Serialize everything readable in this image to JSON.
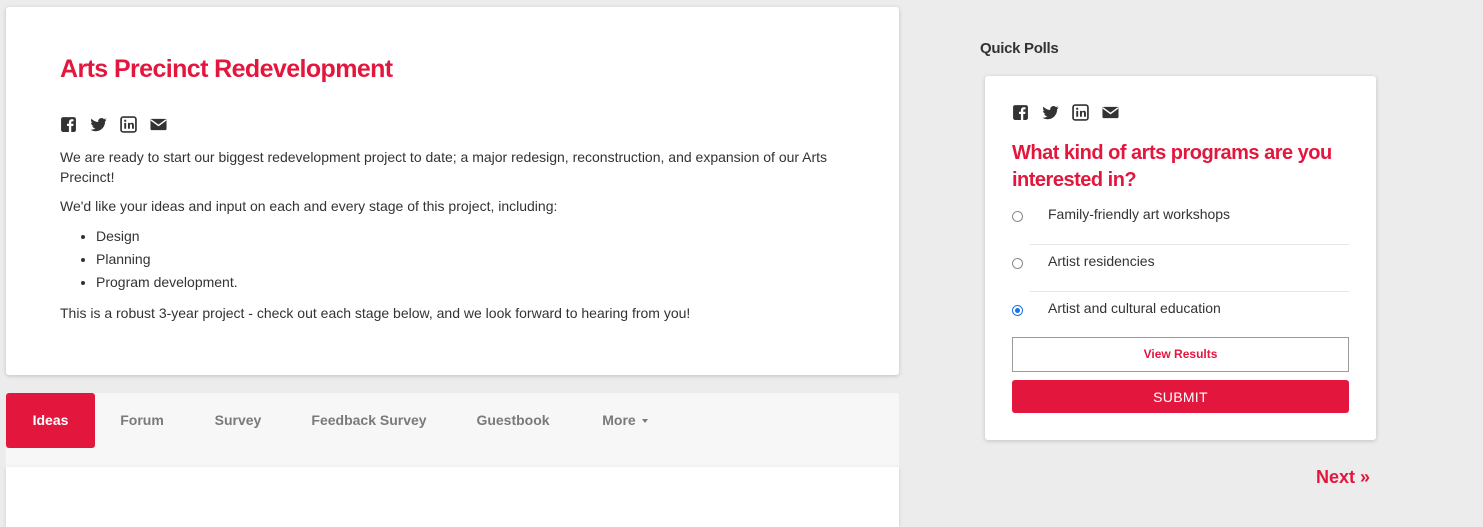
{
  "project": {
    "title": "Arts Precinct Redevelopment",
    "intro": "We are ready to start our biggest redevelopment project to date; a major redesign, reconstruction, and expansion of our Arts Precinct!",
    "prompt": "We'd like your ideas and input on each and every stage of this project, including:",
    "stages": [
      "Design",
      "Planning",
      "Program development."
    ],
    "closing": "This is a robust 3-year project - check out each stage below, and we look forward to hearing from you!"
  },
  "share_icons": [
    "facebook-icon",
    "twitter-icon",
    "linkedin-icon",
    "email-icon"
  ],
  "tabs": {
    "items": [
      {
        "label": "Ideas",
        "active": true
      },
      {
        "label": "Forum",
        "active": false
      },
      {
        "label": "Survey",
        "active": false
      },
      {
        "label": "Feedback Survey",
        "active": false
      },
      {
        "label": "Guestbook",
        "active": false
      },
      {
        "label": "More",
        "active": false
      }
    ]
  },
  "polls": {
    "heading": "Quick Polls",
    "question": "What kind of arts programs are you interested in?",
    "options": [
      {
        "label": "Family-friendly art workshops",
        "selected": false
      },
      {
        "label": "Artist residencies",
        "selected": false
      },
      {
        "label": "Artist and cultural education",
        "selected": true
      }
    ],
    "view_results_label": "View Results",
    "submit_label": "SUBMIT",
    "next_label": "Next »"
  },
  "colors": {
    "accent": "#e3173e",
    "text": "#333333",
    "tab_inactive": "#7a7a7a",
    "radio_selected": "#1a73e8",
    "background": "#ececec"
  }
}
